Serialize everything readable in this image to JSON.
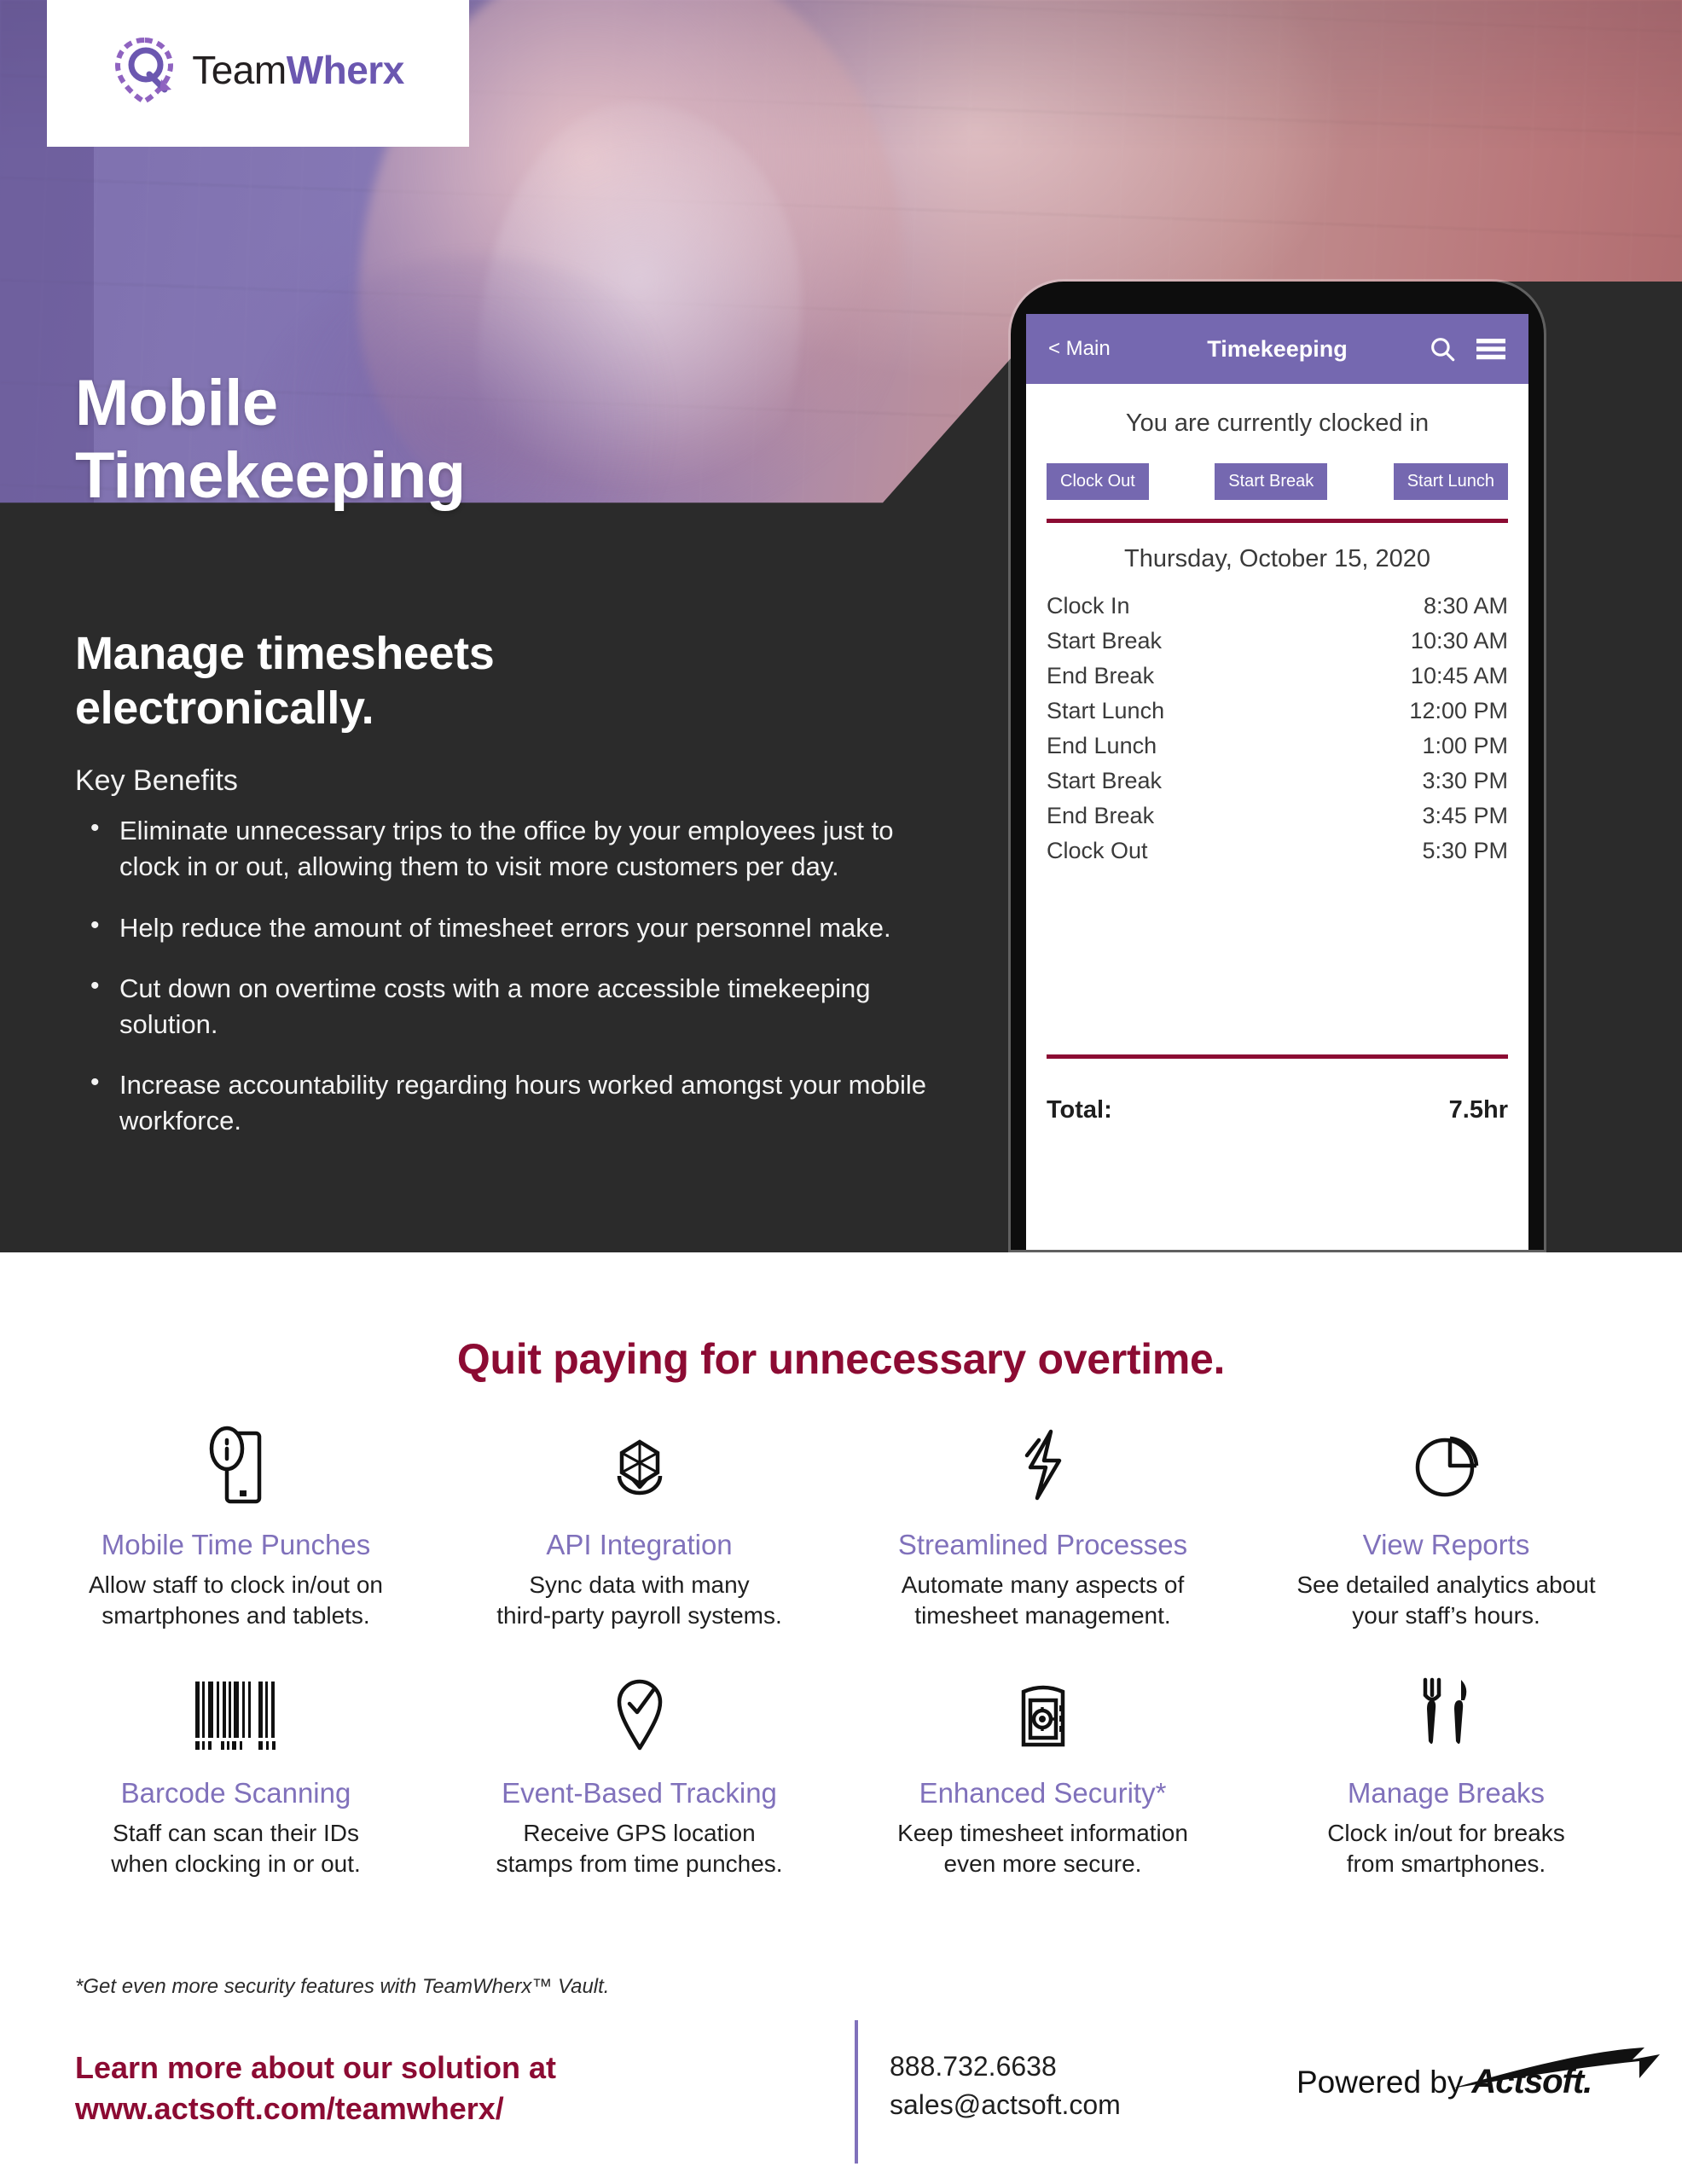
{
  "brand": {
    "logo_text_part1": "Team",
    "logo_text_part2": "Wherx",
    "logo_icon": "teamwherx-location-pin-logo"
  },
  "hero": {
    "title_line1": "Mobile",
    "title_line2": "Timekeeping",
    "overlay_colors": {
      "purple": "#7d6fae",
      "rose": "#b9777a",
      "dark_panel": "#2b2b2b"
    }
  },
  "body": {
    "headline_line1": "Manage timesheets",
    "headline_line2": "electronically.",
    "key_benefits_label": "Key Benefits",
    "bullets": [
      "Eliminate unnecessary trips to the office by your employees just to clock in or out, allowing them to visit more customers per day.",
      "Help reduce the amount of timesheet errors your personnel make.",
      "Cut down on overtime costs with a more accessible timekeeping solution.",
      "Increase accountability regarding hours worked amongst your mobile workforce."
    ]
  },
  "phone": {
    "app_bar": {
      "back_label": "< Main",
      "title": "Timekeeping",
      "search_icon": "search-icon",
      "menu_icon": "hamburger-menu-icon",
      "bar_color": "#7568b0"
    },
    "status_text": "You are currently clocked in",
    "buttons": [
      "Clock Out",
      "Start Break",
      "Start Lunch"
    ],
    "date_header": "Thursday, October 15, 2020",
    "entries": [
      {
        "label": "Clock In",
        "time": "8:30 AM"
      },
      {
        "label": "Start Break",
        "time": "10:30 AM"
      },
      {
        "label": "End Break",
        "time": "10:45 AM"
      },
      {
        "label": "Start Lunch",
        "time": "12:00 PM"
      },
      {
        "label": "End Lunch",
        "time": "1:00 PM"
      },
      {
        "label": "Start Break",
        "time": "3:30 PM"
      },
      {
        "label": "End Break",
        "time": "3:45 PM"
      },
      {
        "label": "Clock Out",
        "time": "5:30 PM"
      }
    ],
    "total_label": "Total:",
    "total_value": "7.5hr",
    "divider_color": "#8c0b33"
  },
  "features_section": {
    "tagline": "Quit paying for unnecessary overtime.",
    "tagline_color": "#8c0b33",
    "title_color": "#8071bb",
    "items": [
      {
        "icon": "mobile-time-punch-icon",
        "title": "Mobile Time Punches",
        "desc_line1": "Allow staff to clock in/out on",
        "desc_line2": "smartphones and tablets."
      },
      {
        "icon": "api-cube-integration-icon",
        "title": "API Integration",
        "desc_line1": "Sync data with many",
        "desc_line2": "third-party payroll systems."
      },
      {
        "icon": "lightning-bolt-icon",
        "title": "Streamlined Processes",
        "desc_line1": "Automate many aspects of",
        "desc_line2": "timesheet management."
      },
      {
        "icon": "pie-chart-icon",
        "title": "View Reports",
        "desc_line1": "See detailed analytics about",
        "desc_line2": "your staff’s hours."
      },
      {
        "icon": "barcode-icon",
        "title": "Barcode Scanning",
        "desc_line1": "Staff can scan their IDs",
        "desc_line2": "when clocking in or out."
      },
      {
        "icon": "map-pin-check-icon",
        "title": "Event-Based Tracking",
        "desc_line1": "Receive GPS location",
        "desc_line2": "stamps from time punches."
      },
      {
        "icon": "safe-vault-icon",
        "title": "Enhanced Security*",
        "desc_line1": "Keep timesheet information",
        "desc_line2": "even more secure."
      },
      {
        "icon": "fork-knife-icon",
        "title": "Manage Breaks",
        "desc_line1": "Clock in/out for breaks",
        "desc_line2": "from smartphones."
      }
    ]
  },
  "footer": {
    "footnote": "*Get even more security features with TeamWherx™ Vault.",
    "cta_line1": "Learn more about our solution at",
    "cta_line2": "www.actsoft.com/teamwherx/",
    "phone": "888.732.6638",
    "email": "sales@actsoft.com",
    "powered_by": "Powered by",
    "powered_brand": "Actsoft.",
    "divider_color": "#8071bb"
  }
}
